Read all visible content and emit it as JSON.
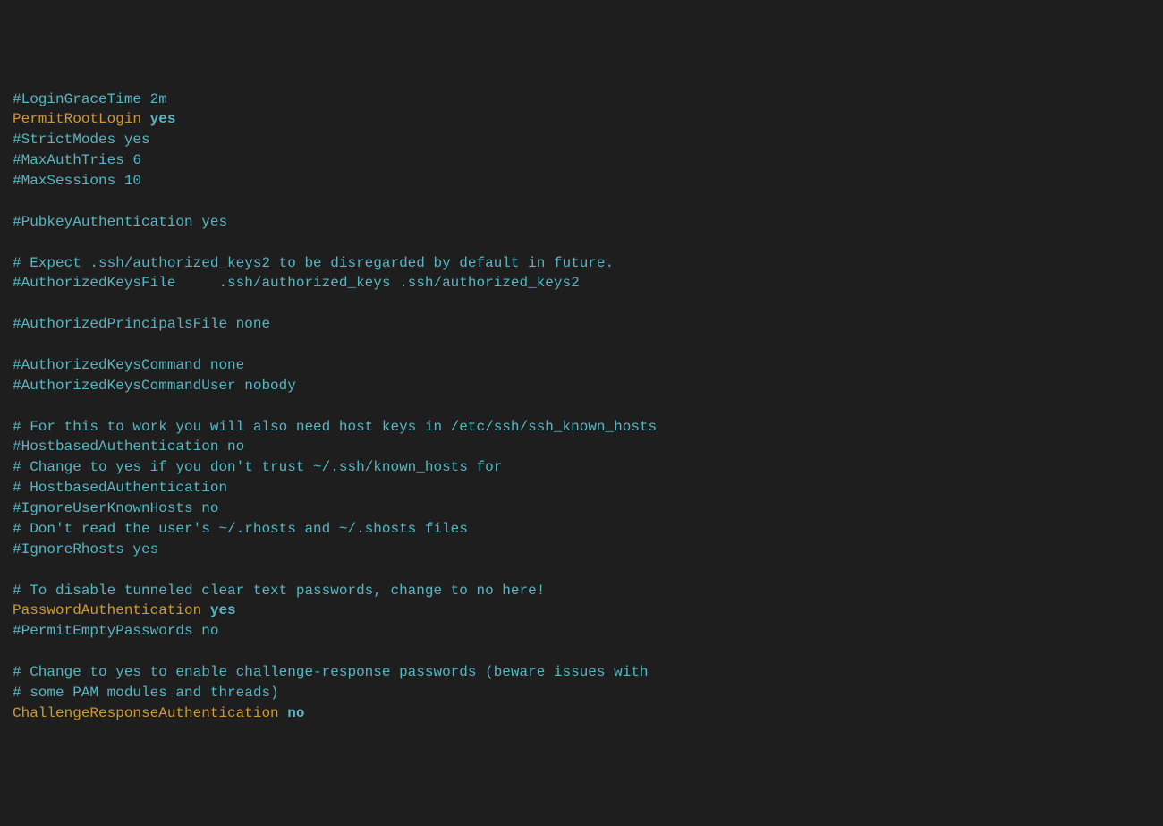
{
  "lines": [
    {
      "segments": [
        {
          "cls": "comment",
          "text": "#LoginGraceTime 2m"
        }
      ]
    },
    {
      "segments": [
        {
          "cls": "keyword",
          "text": "PermitRootLogin "
        },
        {
          "cls": "value-bold",
          "text": "yes"
        }
      ]
    },
    {
      "segments": [
        {
          "cls": "comment",
          "text": "#StrictModes yes"
        }
      ]
    },
    {
      "segments": [
        {
          "cls": "comment",
          "text": "#MaxAuthTries 6"
        }
      ]
    },
    {
      "segments": [
        {
          "cls": "comment",
          "text": "#MaxSessions 10"
        }
      ]
    },
    {
      "segments": [
        {
          "cls": "comment",
          "text": ""
        }
      ]
    },
    {
      "segments": [
        {
          "cls": "comment",
          "text": "#PubkeyAuthentication yes"
        }
      ]
    },
    {
      "segments": [
        {
          "cls": "comment",
          "text": ""
        }
      ]
    },
    {
      "segments": [
        {
          "cls": "comment",
          "text": "# Expect .ssh/authorized_keys2 to be disregarded by default in future."
        }
      ]
    },
    {
      "segments": [
        {
          "cls": "comment",
          "text": "#AuthorizedKeysFile     .ssh/authorized_keys .ssh/authorized_keys2"
        }
      ]
    },
    {
      "segments": [
        {
          "cls": "comment",
          "text": ""
        }
      ]
    },
    {
      "segments": [
        {
          "cls": "comment",
          "text": "#AuthorizedPrincipalsFile none"
        }
      ]
    },
    {
      "segments": [
        {
          "cls": "comment",
          "text": ""
        }
      ]
    },
    {
      "segments": [
        {
          "cls": "comment",
          "text": "#AuthorizedKeysCommand none"
        }
      ]
    },
    {
      "segments": [
        {
          "cls": "comment",
          "text": "#AuthorizedKeysCommandUser nobody"
        }
      ]
    },
    {
      "segments": [
        {
          "cls": "comment",
          "text": ""
        }
      ]
    },
    {
      "segments": [
        {
          "cls": "comment",
          "text": "# For this to work you will also need host keys in /etc/ssh/ssh_known_hosts"
        }
      ]
    },
    {
      "segments": [
        {
          "cls": "comment",
          "text": "#HostbasedAuthentication no"
        }
      ]
    },
    {
      "segments": [
        {
          "cls": "comment",
          "text": "# Change to yes if you don't trust ~/.ssh/known_hosts for"
        }
      ]
    },
    {
      "segments": [
        {
          "cls": "comment",
          "text": "# HostbasedAuthentication"
        }
      ]
    },
    {
      "segments": [
        {
          "cls": "comment",
          "text": "#IgnoreUserKnownHosts no"
        }
      ]
    },
    {
      "segments": [
        {
          "cls": "comment",
          "text": "# Don't read the user's ~/.rhosts and ~/.shosts files"
        }
      ]
    },
    {
      "segments": [
        {
          "cls": "comment",
          "text": "#IgnoreRhosts yes"
        }
      ]
    },
    {
      "segments": [
        {
          "cls": "comment",
          "text": ""
        }
      ]
    },
    {
      "segments": [
        {
          "cls": "comment",
          "text": "# To disable tunneled clear text passwords, change to no here!"
        }
      ]
    },
    {
      "segments": [
        {
          "cls": "keyword",
          "text": "PasswordAuthentication "
        },
        {
          "cls": "value-bold",
          "text": "yes"
        }
      ]
    },
    {
      "segments": [
        {
          "cls": "comment",
          "text": "#PermitEmptyPasswords no"
        }
      ]
    },
    {
      "segments": [
        {
          "cls": "comment",
          "text": ""
        }
      ]
    },
    {
      "segments": [
        {
          "cls": "comment",
          "text": "# Change to yes to enable challenge-response passwords (beware issues with"
        }
      ]
    },
    {
      "segments": [
        {
          "cls": "comment",
          "text": "# some PAM modules and threads)"
        }
      ]
    },
    {
      "segments": [
        {
          "cls": "keyword",
          "text": "ChallengeResponseAuthentication "
        },
        {
          "cls": "value-bold",
          "text": "no"
        }
      ]
    }
  ]
}
